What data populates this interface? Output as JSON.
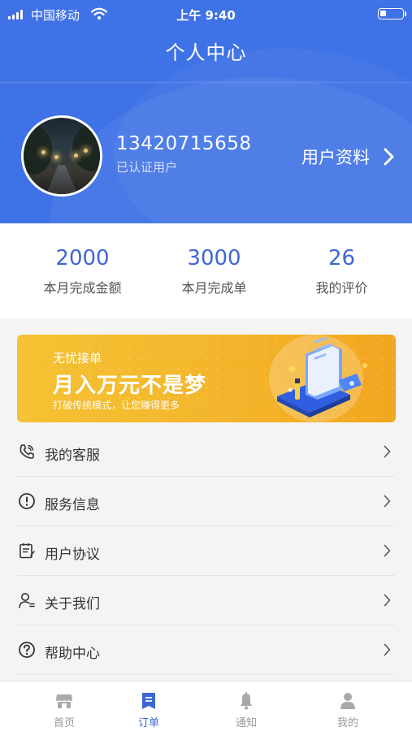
{
  "status_bar": {
    "carrier": "中国移动",
    "time": "上午 9:40"
  },
  "page": {
    "title": "个人中心"
  },
  "profile": {
    "phone": "13420715658",
    "status": "已认证用户",
    "link_label": "用户资料"
  },
  "stats": [
    {
      "value": "2000",
      "label": "本月完成金额"
    },
    {
      "value": "3000",
      "label": "本月完成单"
    },
    {
      "value": "26",
      "label": "我的评价"
    }
  ],
  "banner": {
    "tag": "无忧接单",
    "headline": "月入万元不是梦",
    "subtitle": "打破传统模式，让您赚得更多"
  },
  "menu": [
    {
      "label": "我的客服",
      "icon": "phone-icon"
    },
    {
      "label": "服务信息",
      "icon": "info-icon"
    },
    {
      "label": "用户协议",
      "icon": "document-icon"
    },
    {
      "label": "关于我们",
      "icon": "user-icon"
    },
    {
      "label": "帮助中心",
      "icon": "help-icon"
    }
  ],
  "tabbar": {
    "active": 1,
    "tabs": [
      {
        "label": "首页",
        "icon": "store-icon"
      },
      {
        "label": "订单",
        "icon": "order-icon"
      },
      {
        "label": "通知",
        "icon": "bell-icon"
      },
      {
        "label": "我的",
        "icon": "person-icon"
      }
    ]
  },
  "colors": {
    "primary": "#3f72e6",
    "accent_text": "#3f66d6",
    "banner": "#f4b62b",
    "background": "#f4f4f4"
  }
}
